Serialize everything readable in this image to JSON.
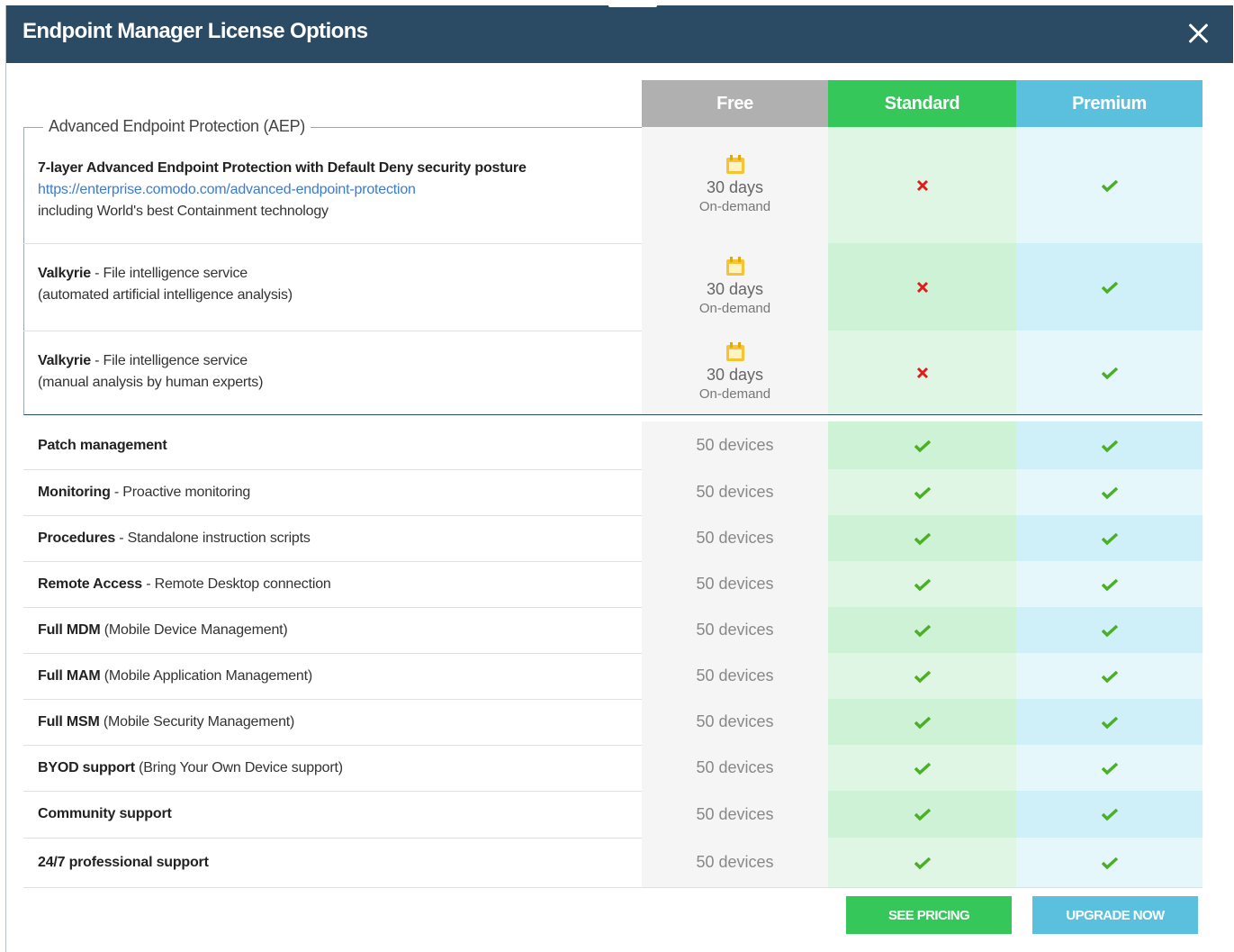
{
  "dialog": {
    "title": "Endpoint Manager License Options"
  },
  "columns": {
    "free": "Free",
    "standard": "Standard",
    "premium": "Premium"
  },
  "colors": {
    "header_bg": "#2b4a64",
    "free": "#b0b0b0",
    "standard": "#35c75a",
    "premium": "#5bc0de",
    "check": "#4caf25",
    "cross": "#e01b1b"
  },
  "aep_group": {
    "legend": "Advanced Endpoint Protection (AEP)",
    "rows": [
      {
        "title": "7-layer Advanced Endpoint Protection with Default Deny security posture",
        "link": "https://enterprise.comodo.com/advanced-endpoint-protection",
        "desc": "including World's best Containment technology",
        "free_days": "30 days",
        "free_mode": "On-demand",
        "standard": "cross",
        "premium": "check"
      },
      {
        "name": "Valkyrie",
        "sep": " - ",
        "line1": "File intelligence service",
        "line2": "(automated artificial intelligence analysis)",
        "free_days": "30 days",
        "free_mode": "On-demand",
        "standard": "cross",
        "premium": "check"
      },
      {
        "name": "Valkyrie",
        "sep": " - ",
        "line1": "File intelligence service",
        "line2": "(manual analysis by human experts)",
        "free_days": "30 days",
        "free_mode": "On-demand",
        "standard": "cross",
        "premium": "check"
      }
    ]
  },
  "rows": [
    {
      "name": "Patch management",
      "rest": "",
      "free": "50 devices",
      "standard": "check",
      "premium": "check"
    },
    {
      "name": "Monitoring",
      "rest": " - Proactive monitoring",
      "free": "50 devices",
      "standard": "check",
      "premium": "check"
    },
    {
      "name": "Procedures",
      "rest": " - Standalone instruction scripts",
      "free": "50 devices",
      "standard": "check",
      "premium": "check"
    },
    {
      "name": "Remote Access",
      "rest": " - Remote Desktop connection",
      "free": "50 devices",
      "standard": "check",
      "premium": "check"
    },
    {
      "name": "Full MDM",
      "rest": " (Mobile Device Management)",
      "free": "50 devices",
      "standard": "check",
      "premium": "check"
    },
    {
      "name": "Full MAM",
      "rest": " (Mobile Application Management)",
      "free": "50 devices",
      "standard": "check",
      "premium": "check"
    },
    {
      "name": "Full MSM",
      "rest": " (Mobile Security Management)",
      "free": "50 devices",
      "standard": "check",
      "premium": "check"
    },
    {
      "name": "BYOD support",
      "rest": " (Bring Your Own Device support)",
      "free": "50 devices",
      "standard": "check",
      "premium": "check"
    },
    {
      "name": "Community support",
      "rest": "",
      "free": "50 devices",
      "standard": "check",
      "premium": "check"
    },
    {
      "name": "24/7 professional support",
      "rest": "",
      "free": "50 devices",
      "standard": "check",
      "premium": "check"
    }
  ],
  "buttons": {
    "see_pricing": "SEE PRICING",
    "upgrade_now": "UPGRADE NOW"
  }
}
